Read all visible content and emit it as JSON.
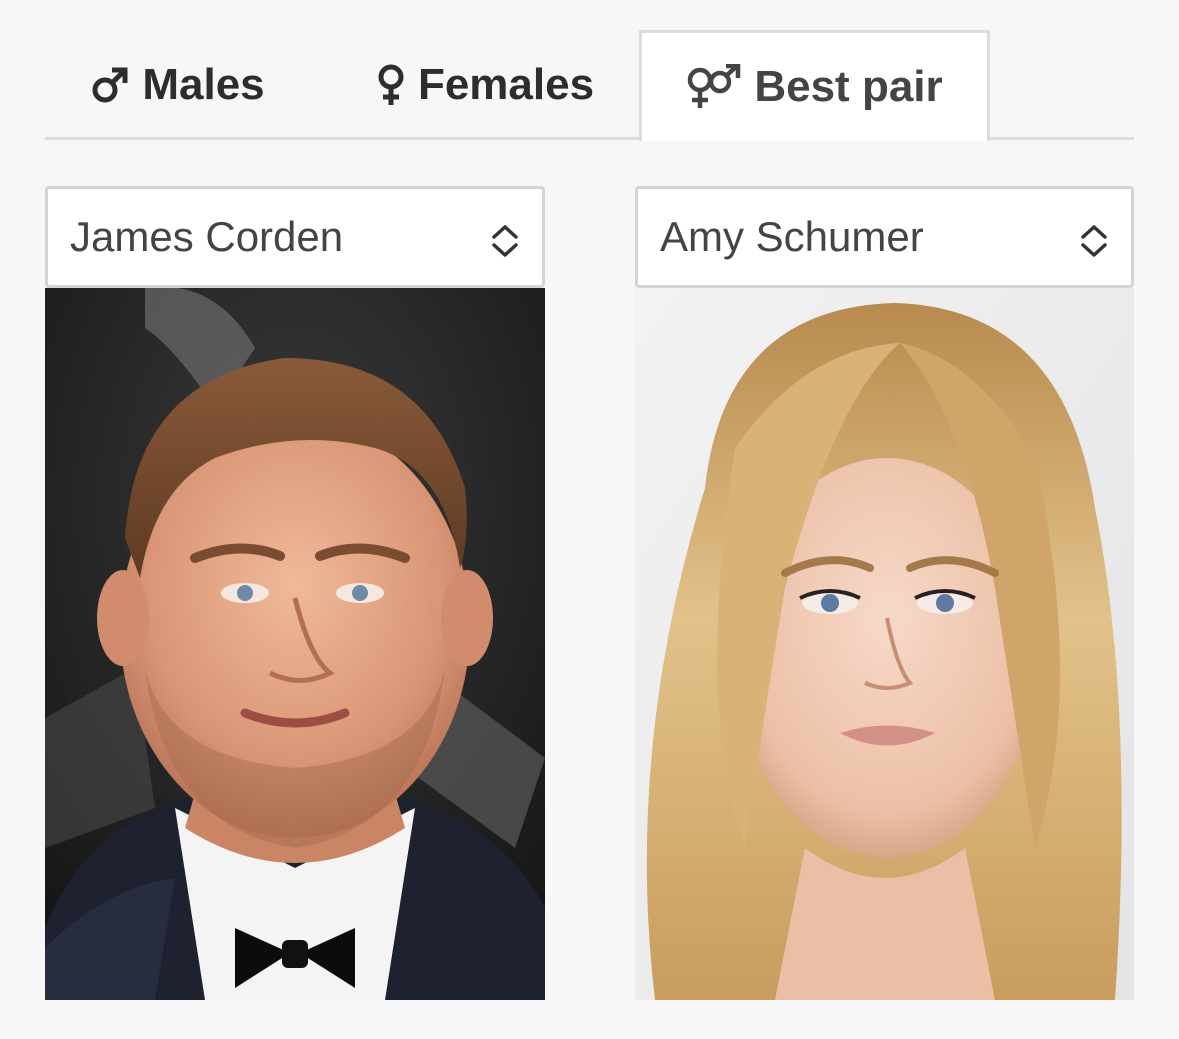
{
  "tabs": [
    {
      "label": "Males",
      "icon": "male-symbol-icon",
      "active": false
    },
    {
      "label": "Females",
      "icon": "female-symbol-icon",
      "active": false
    },
    {
      "label": "Best pair",
      "icon": "male-female-symbol-icon",
      "active": true
    }
  ],
  "selects": {
    "left": {
      "value": "James Corden",
      "icon": "up-down-chevron-icon"
    },
    "right": {
      "value": "Amy Schumer",
      "icon": "up-down-chevron-icon"
    }
  },
  "colors": {
    "background": "#f7f7f7",
    "tab_border": "#dcdcdc",
    "text": "#2d2d2d"
  }
}
